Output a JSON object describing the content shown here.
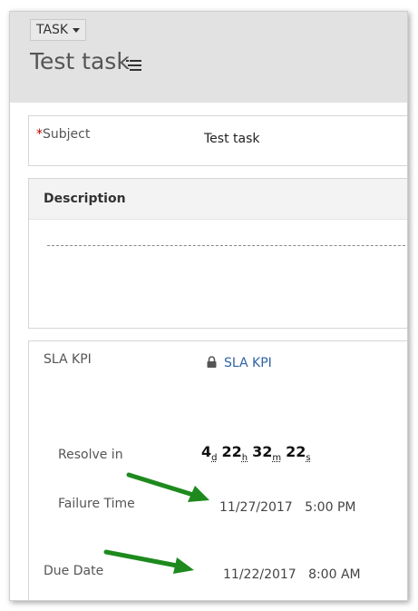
{
  "header": {
    "entity_label": "TASK",
    "record_title": "Test task"
  },
  "subject": {
    "label": "Subject",
    "required_marker": "*",
    "value": "Test task"
  },
  "description": {
    "title": "Description"
  },
  "sla": {
    "label": "SLA KPI",
    "link_text": "SLA KPI",
    "resolve_in": {
      "label": "Resolve in",
      "days": "4",
      "days_unit": "d",
      "hours": "22",
      "hours_unit": "h",
      "minutes": "32",
      "minutes_unit": "m",
      "seconds": "22",
      "seconds_unit": "s"
    },
    "failure_time": {
      "label": "Failure Time",
      "date": "11/27/2017",
      "time": "5:00 PM"
    }
  },
  "due_date": {
    "label": "Due Date",
    "date": "11/22/2017",
    "time": "8:00 AM"
  },
  "colors": {
    "accent_link": "#2f62a6",
    "annotation_arrow": "#1e8a1e",
    "required": "#c00000"
  }
}
